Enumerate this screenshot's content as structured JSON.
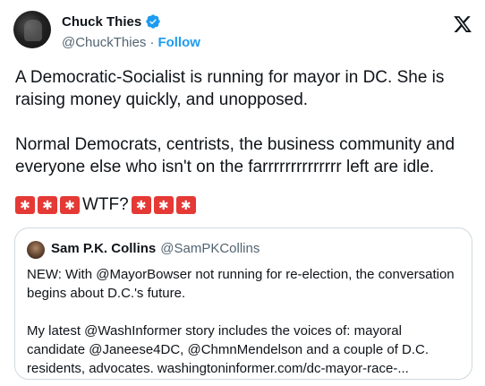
{
  "author": {
    "name": "Chuck Thies",
    "handle": "@ChuckThies",
    "dot": "·",
    "follow_label": "Follow",
    "verified_icon": "verified-badge-icon"
  },
  "brand_icon": "x-logo-icon",
  "tweet": {
    "text": "A Democratic-Socialist is running for mayor in DC. She is raising money quickly, and unopposed.\n\nNormal Democrats, centrists, the business community and everyone else who isn't on the farrrrrrrrrrrrrr left are idle.",
    "emoji_text": "WTF?",
    "emoji_icon": "police-light-icon"
  },
  "quote": {
    "name": "Sam P.K. Collins",
    "handle": "@SamPKCollins",
    "text": "NEW: With @MayorBowser not running for re-election, the conversation begins about D.C.'s future.\n\nMy latest @WashInformer story includes the voices of: mayoral candidate @Janeese4DC, @ChmnMendelson and a couple of D.C. residents, advocates. washingtoninformer.com/dc-mayor-race-..."
  },
  "colors": {
    "accent": "#1d9bf0",
    "text": "#0f1419",
    "muted": "#536471",
    "border": "#cfd9de",
    "siren": "#e53935"
  }
}
